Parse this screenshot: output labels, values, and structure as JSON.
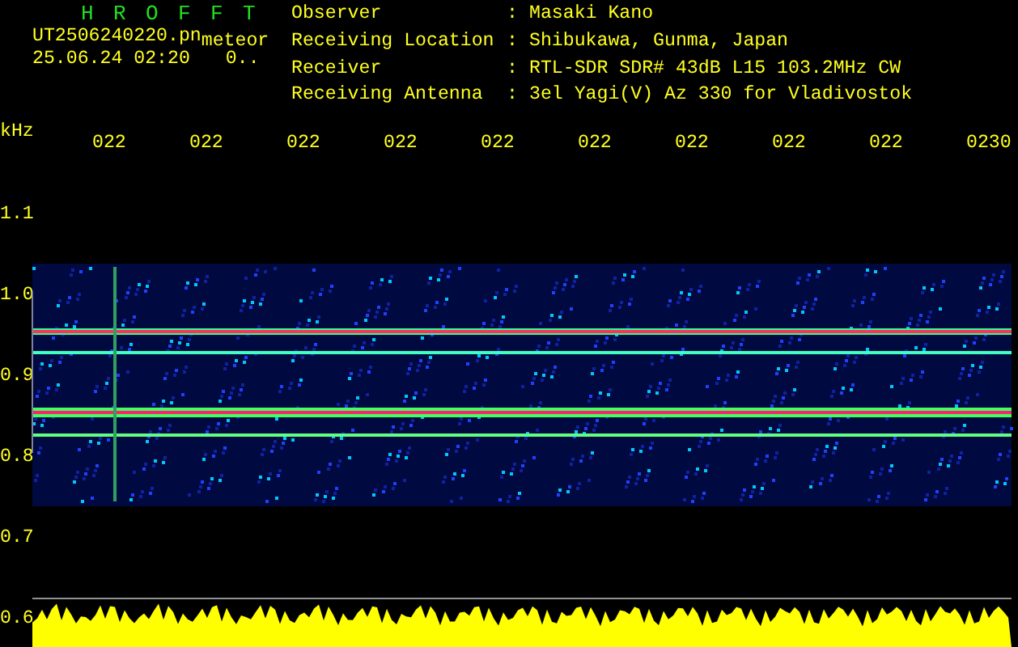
{
  "header": {
    "title": "H R O F F T",
    "file_name": "UT2506240220.pn",
    "mode": "meteor",
    "date_time": "25.06.24 02:20",
    "value": "0.."
  },
  "info": [
    {
      "label": "Observer",
      "separator": ":",
      "value": "Masaki Kano"
    },
    {
      "label": "Receiving Location",
      "separator": ":",
      "value": "Shibukawa, Gunma, Japan"
    },
    {
      "label": "Receiver",
      "separator": ":",
      "value": "RTL-SDR SDR# 43dB L15 103.2MHz CW"
    },
    {
      "label": "Receiving Antenna",
      "separator": ":",
      "value": "3el Yagi(V) Az 330 for Vladivostok"
    }
  ],
  "plot": {
    "unit": "kHz",
    "time_labels": [
      "022",
      "022",
      "022",
      "022",
      "022",
      "022",
      "022",
      "022",
      "022",
      "0230"
    ],
    "frequency_labels": [
      "1.1",
      "1.0",
      "0.9",
      "0.8",
      "0.7",
      "0.6"
    ]
  }
}
